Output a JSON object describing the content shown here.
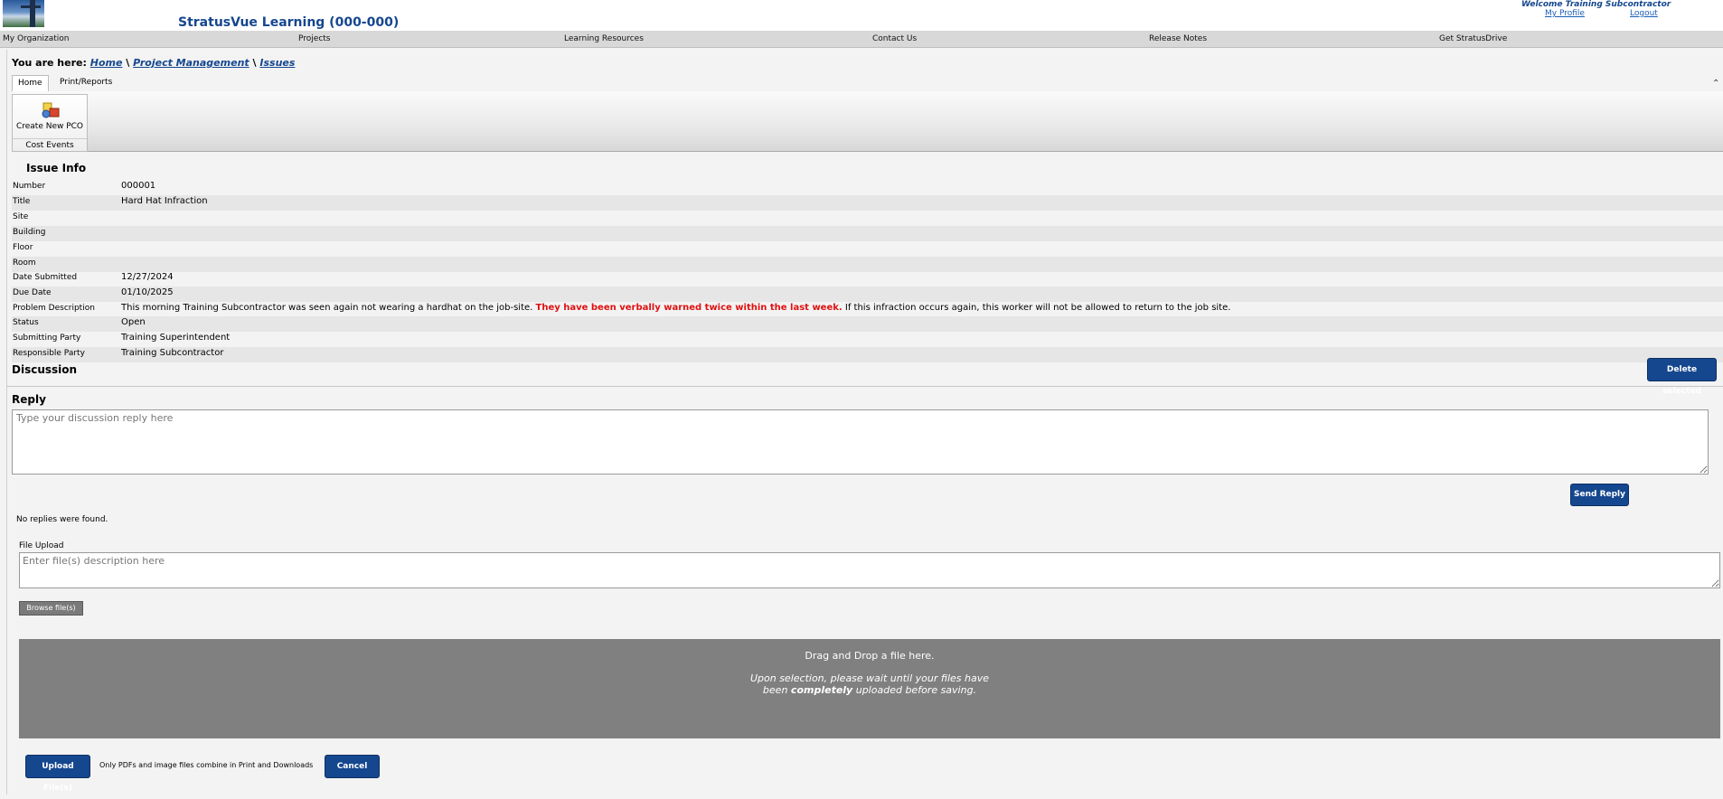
{
  "header": {
    "app_title": "StratusVue Learning (000-000)",
    "welcome": "Welcome  Training Subcontractor",
    "my_profile": "My Profile",
    "logout": "Logout"
  },
  "nav": [
    "My Organization",
    "Projects",
    "Learning Resources",
    "Contact Us",
    "Release Notes",
    "Get StratusDrive"
  ],
  "breadcrumb": {
    "prefix": "You are here:",
    "sep": "\\",
    "items": [
      "Home",
      "Project Management",
      "Issues"
    ]
  },
  "ribbon": {
    "tabs": [
      "Home",
      "Print/Reports"
    ],
    "button_label": "Create New PCO",
    "group_label": "Cost Events"
  },
  "issue_info": {
    "title": "Issue Info",
    "rows": [
      {
        "label": "Number",
        "value": "000001"
      },
      {
        "label": "Title",
        "value": "Hard Hat Infraction"
      },
      {
        "label": "Site",
        "value": ""
      },
      {
        "label": "Building",
        "value": ""
      },
      {
        "label": "Floor",
        "value": ""
      },
      {
        "label": "Room",
        "value": ""
      },
      {
        "label": "Date Submitted",
        "value": "12/27/2024"
      },
      {
        "label": "Due Date",
        "value": "01/10/2025"
      },
      {
        "label": "Problem Description",
        "value": ""
      },
      {
        "label": "Status",
        "value": "Open"
      },
      {
        "label": "Submitting Party",
        "value": "Training Superintendent"
      },
      {
        "label": "Responsible Party",
        "value": "Training Subcontractor"
      }
    ],
    "description": {
      "part1": "This morning Training Subcontractor was seen again not wearing a hardhat on the job-site. ",
      "part2": "They have been verbally warned twice within the last week.",
      "part3": " If this infraction occurs again, this worker will not be allowed to return to the job site."
    }
  },
  "discussion": {
    "title": "Discussion",
    "delete_label": "Delete selected",
    "reply_title": "Reply",
    "reply_placeholder": "Type your discussion reply here",
    "send_label": "Send Reply",
    "no_replies": "No replies were found."
  },
  "upload": {
    "label": "File Upload",
    "placeholder": "Enter file(s) description here",
    "browse_label": "Browse file(s)",
    "drop_line1": "Drag and Drop a file here.",
    "drop_line2a": "Upon selection, please wait until your files have",
    "drop_line2b": "been ",
    "drop_line2c": "completely",
    "drop_line2d": " uploaded before saving.",
    "upload_label": "Upload File(s)",
    "note": "Only PDFs and image files combine in Print and Downloads",
    "cancel_label": "Cancel"
  },
  "colors": {
    "brand": "#15478f",
    "warning": "#e01010",
    "dropzone": "#808080"
  }
}
